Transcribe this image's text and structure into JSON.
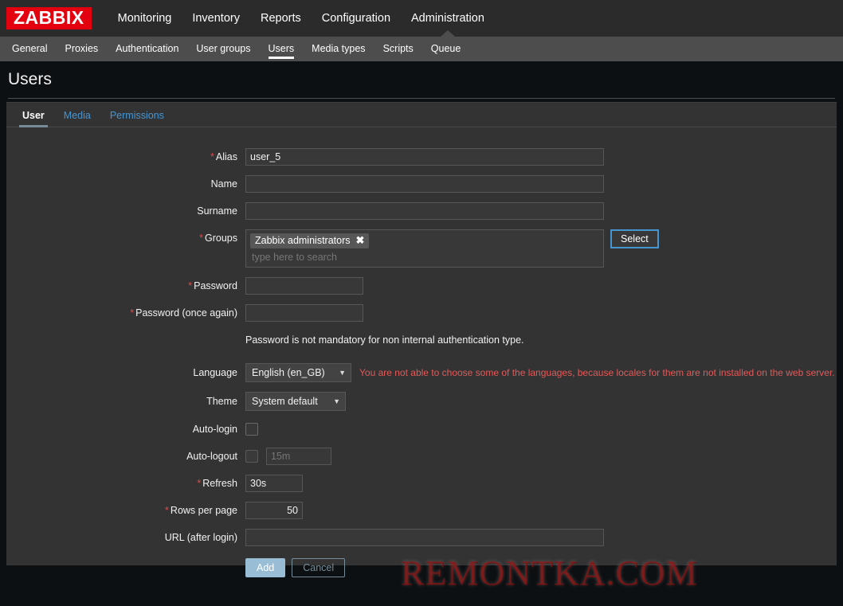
{
  "brand": {
    "logo_text": "ZABBIX",
    "logo_bg": "#e3000f"
  },
  "topnav": {
    "items": [
      {
        "label": "Monitoring",
        "active": false
      },
      {
        "label": "Inventory",
        "active": false
      },
      {
        "label": "Reports",
        "active": false
      },
      {
        "label": "Configuration",
        "active": false
      },
      {
        "label": "Administration",
        "active": true
      }
    ]
  },
  "subnav": {
    "items": [
      {
        "label": "General",
        "active": false
      },
      {
        "label": "Proxies",
        "active": false
      },
      {
        "label": "Authentication",
        "active": false
      },
      {
        "label": "User groups",
        "active": false
      },
      {
        "label": "Users",
        "active": true
      },
      {
        "label": "Media types",
        "active": false
      },
      {
        "label": "Scripts",
        "active": false
      },
      {
        "label": "Queue",
        "active": false
      }
    ]
  },
  "header": {
    "title": "Users"
  },
  "tabs": [
    {
      "label": "User",
      "active": true
    },
    {
      "label": "Media",
      "active": false
    },
    {
      "label": "Permissions",
      "active": false
    }
  ],
  "form": {
    "alias": {
      "label": "Alias",
      "required": true,
      "value": "user_5"
    },
    "name": {
      "label": "Name",
      "required": false,
      "value": ""
    },
    "surname": {
      "label": "Surname",
      "required": false,
      "value": ""
    },
    "groups": {
      "label": "Groups",
      "required": true,
      "chips": [
        "Zabbix administrators"
      ],
      "chip_remove_icon": "✖",
      "search_placeholder": "type here to search",
      "select_button": "Select"
    },
    "password": {
      "label": "Password",
      "required": true,
      "value": ""
    },
    "password_again": {
      "label": "Password (once again)",
      "required": true,
      "value": ""
    },
    "password_hint": "Password is not mandatory for non internal authentication type.",
    "language": {
      "label": "Language",
      "required": false,
      "value": "English (en_GB)",
      "warning": "You are not able to choose some of the languages, because locales for them are not installed on the web server."
    },
    "theme": {
      "label": "Theme",
      "required": false,
      "value": "System default"
    },
    "auto_login": {
      "label": "Auto-login",
      "required": false,
      "checked": false
    },
    "auto_logout": {
      "label": "Auto-logout",
      "required": false,
      "checked": false,
      "value": "",
      "placeholder": "15m",
      "disabled": true
    },
    "refresh": {
      "label": "Refresh",
      "required": true,
      "value": "30s"
    },
    "rows_per_page": {
      "label": "Rows per page",
      "required": true,
      "value": "50"
    },
    "url_after_login": {
      "label": "URL (after login)",
      "required": false,
      "value": ""
    },
    "buttons": {
      "submit": "Add",
      "cancel": "Cancel"
    }
  },
  "watermark": {
    "text": "REMONTKA.COM"
  }
}
